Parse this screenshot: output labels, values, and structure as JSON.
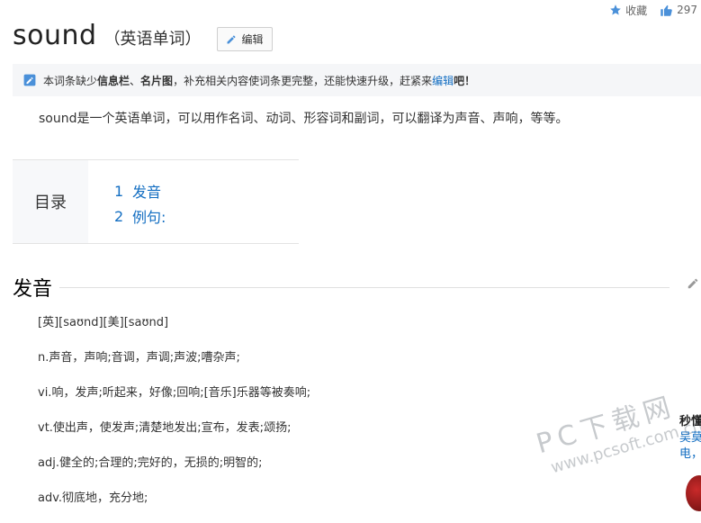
{
  "topbar": {
    "fav_label": "收藏",
    "like_count": "297"
  },
  "entry": {
    "title": "sound",
    "subtitle": "（英语单词）",
    "edit_label": "编辑"
  },
  "notice": {
    "prefix": "本词条缺少",
    "item1": "信息栏",
    "sep": "、",
    "item2": "名片图",
    "middle": "，补充相关内容使词条更完整，还能快速升级，赶紧来",
    "link": "编辑",
    "suffix": "吧！"
  },
  "summary": "sound是一个英语单词，可以用作名词、动词、形容词和副词，可以翻译为声音、声响，等等。",
  "toc": {
    "label": "目录",
    "items": [
      {
        "num": "1",
        "label": "发音"
      },
      {
        "num": "2",
        "label": "例句:"
      }
    ]
  },
  "section": {
    "heading": "发音"
  },
  "definitions": [
    "[英][saʊnd][美][saʊnd]",
    "n.声音，声响;音调，声调;声波;嘈杂声;",
    "vi.响，发声;听起来，好像;回响;[音乐]乐器等被奏响;",
    "vt.使出声，使发声;清楚地发出;宣布，发表;颂扬;",
    "adj.健全的;合理的;完好的，无损的;明智的;",
    "adv.彻底地，充分地;"
  ],
  "watermark": {
    "big": "PC下载网",
    "small": "www.pcsoft.com.cn"
  },
  "side_snippet": {
    "line1": "秒懂",
    "line2": "吴莫",
    "line3": "电，"
  },
  "colors": {
    "link": "#136ec2",
    "notice_bg": "#f5f6f8",
    "toc_bg": "#f7f8fa",
    "icon_blue": "#4a90d9"
  }
}
